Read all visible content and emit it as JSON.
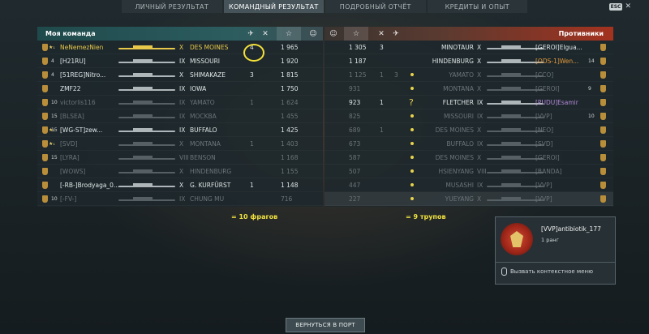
{
  "tabs": [
    {
      "label": "ЛИЧНЫЙ РЕЗУЛЬТАТ",
      "active": false
    },
    {
      "label": "КОМАНДНЫЙ РЕЗУЛЬТАТ",
      "active": true
    },
    {
      "label": "ПОДРОБНЫЙ ОТЧЁТ",
      "active": false
    },
    {
      "label": "КРЕДИТЫ И ОПЫТ",
      "active": false
    }
  ],
  "esc_key": "ESC",
  "my_team": {
    "title": "Моя команда",
    "rows": [
      {
        "level": "",
        "name": "NeNemezNien",
        "tier": "X",
        "ship": "DES MOINES",
        "frags": "4",
        "planes": "",
        "exp": "1 965",
        "style": "gold"
      },
      {
        "level": "4",
        "name": "[H21RU]",
        "tier": "IX",
        "ship": "MISSOURI",
        "frags": "",
        "planes": "",
        "exp": "1 920",
        "style": "normal"
      },
      {
        "level": "4",
        "name": "[51REG]Nitro...",
        "tier": "X",
        "ship": "SHIMAKAZE",
        "frags": "3",
        "planes": "",
        "exp": "1 815",
        "style": "normal"
      },
      {
        "level": "",
        "name": "ZMF22",
        "tier": "IX",
        "ship": "IOWA",
        "frags": "",
        "planes": "",
        "exp": "1 750",
        "style": "normal"
      },
      {
        "level": "10",
        "name": "victorlis116",
        "tier": "IX",
        "ship": "YAMATO",
        "frags": "1",
        "planes": "",
        "exp": "1 624",
        "style": "dim"
      },
      {
        "level": "15",
        "name": "[BLSEA]",
        "tier": "IX",
        "ship": "MOCKBA",
        "frags": "",
        "planes": "",
        "exp": "1 455",
        "style": "dim"
      },
      {
        "level": "15",
        "name": "[WG-ST]zew...",
        "tier": "IX",
        "ship": "BUFFALO",
        "frags": "",
        "planes": "",
        "exp": "1 425",
        "style": "normal"
      },
      {
        "level": "",
        "name": "[SVD]",
        "tier": "X",
        "ship": "MONTANA",
        "frags": "1",
        "planes": "",
        "exp": "1 403",
        "style": "dim"
      },
      {
        "level": "15",
        "name": "[LYRA]",
        "tier": "VIII",
        "ship": "BENSON",
        "frags": "",
        "planes": "",
        "exp": "1 168",
        "style": "dim"
      },
      {
        "level": "",
        "name": "[WOWS]",
        "tier": "X",
        "ship": "HINDENBURG",
        "frags": "",
        "planes": "",
        "exp": "1 155",
        "style": "dim"
      },
      {
        "level": "",
        "name": "[-RB-]Brodyaga_0...",
        "tier": "X",
        "ship": "G. KURFÜRST",
        "frags": "1",
        "planes": "",
        "exp": "1 148",
        "style": "normal"
      },
      {
        "level": "10",
        "name": "[-FV-]",
        "tier": "IX",
        "ship": "CHUNG MU",
        "frags": "",
        "planes": "",
        "exp": "716",
        "style": "dim"
      }
    ]
  },
  "enemy_team": {
    "title": "Противники",
    "rows": [
      {
        "exp": "1 305",
        "frags": "3",
        "planes": "",
        "ship": "MINOTAUR",
        "tier": "X",
        "name": "[GEROI]Elgua...",
        "level": "",
        "style": "normal",
        "marker": ""
      },
      {
        "exp": "1 187",
        "frags": "",
        "planes": "",
        "ship": "HINDENBURG",
        "tier": "X",
        "name": "[ODS-1]Wen...",
        "level": "14",
        "style": "normal",
        "marker": ""
      },
      {
        "exp": "1 125",
        "frags": "1",
        "planes": "3",
        "ship": "YAMATO",
        "tier": "X",
        "name": "[CCO]",
        "level": "",
        "style": "dim",
        "marker": "dot"
      },
      {
        "exp": "931",
        "frags": "",
        "planes": "",
        "ship": "MONTANA",
        "tier": "X",
        "name": "[GEROI]",
        "level": "9",
        "style": "dim",
        "marker": "dot"
      },
      {
        "exp": "923",
        "frags": "1",
        "planes": "",
        "ship": "FLETCHER",
        "tier": "IX",
        "name": "[PUDU]Esamir",
        "level": "",
        "style": "normal",
        "marker": "question"
      },
      {
        "exp": "825",
        "frags": "",
        "planes": "",
        "ship": "MISSOURI",
        "tier": "IX",
        "name": "[VVP]",
        "level": "10",
        "style": "dim",
        "marker": "dot"
      },
      {
        "exp": "689",
        "frags": "1",
        "planes": "",
        "ship": "DES MOINES",
        "tier": "X",
        "name": "[NEO]",
        "level": "",
        "style": "dim",
        "marker": "dot"
      },
      {
        "exp": "673",
        "frags": "",
        "planes": "",
        "ship": "BUFFALO",
        "tier": "IX",
        "name": "[SVD]",
        "level": "",
        "style": "dim",
        "marker": "dot"
      },
      {
        "exp": "587",
        "frags": "",
        "planes": "",
        "ship": "DES MOINES",
        "tier": "X",
        "name": "[GEROI]",
        "level": "",
        "style": "dim",
        "marker": "dot"
      },
      {
        "exp": "507",
        "frags": "",
        "planes": "",
        "ship": "HSIENYANG",
        "tier": "VIII",
        "name": "[BANDA]",
        "level": "",
        "style": "dim",
        "marker": "dot"
      },
      {
        "exp": "447",
        "frags": "",
        "planes": "",
        "ship": "MUSASHI",
        "tier": "IX",
        "name": "[VVP]",
        "level": "",
        "style": "dim",
        "marker": "dot"
      },
      {
        "exp": "227",
        "frags": "",
        "planes": "",
        "ship": "YUEYANG",
        "tier": "X",
        "name": "[VVP]",
        "level": "",
        "style": "dim",
        "marker": "dot"
      }
    ]
  },
  "annotations": {
    "frags_total": "= 10 фрагов",
    "wrecks_total": "= 9 трупов"
  },
  "player_card": {
    "name": "[VVP]antibiotik_177",
    "rank": "1 ранг",
    "hint": "Вызвать контекстное меню"
  },
  "return_button": "ВЕРНУТЬСЯ В ПОРТ"
}
